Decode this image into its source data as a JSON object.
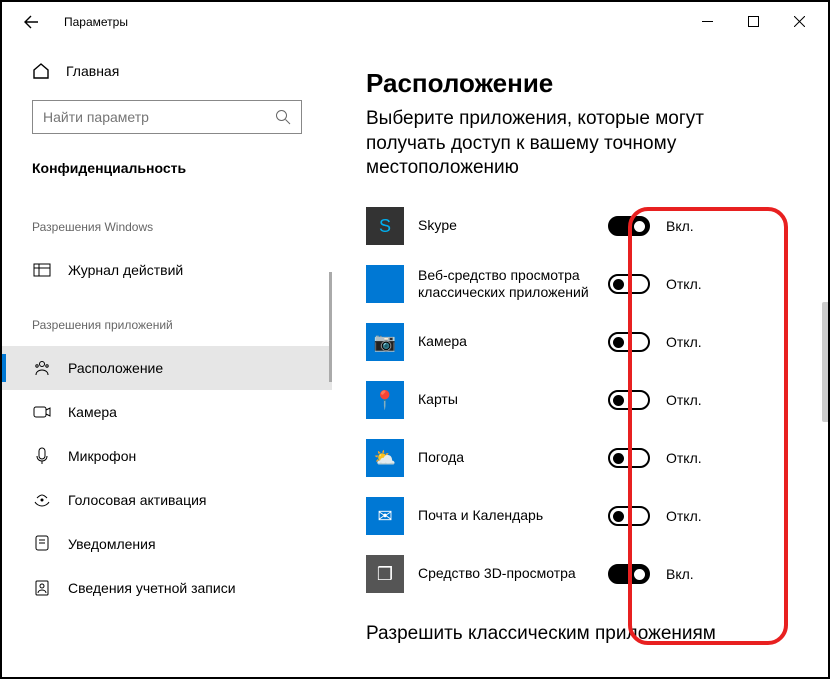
{
  "window": {
    "title": "Параметры"
  },
  "sidebar": {
    "home": "Главная",
    "search_placeholder": "Найти параметр",
    "category": "Конфиденциальность",
    "section1": "Разрешения Windows",
    "section2": "Разрешения приложений",
    "items1": [
      {
        "label": "Журнал действий"
      }
    ],
    "items2": [
      {
        "label": "Расположение"
      },
      {
        "label": "Камера"
      },
      {
        "label": "Микрофон"
      },
      {
        "label": "Голосовая активация"
      },
      {
        "label": "Уведомления"
      },
      {
        "label": "Сведения учетной записи"
      }
    ]
  },
  "main": {
    "title": "Расположение",
    "subtitle": "Выберите приложения, которые могут получать доступ к вашему точному местоположению",
    "bottom": "Разрешить классическим приложениям",
    "on_label": "Вкл.",
    "off_label": "Откл.",
    "apps": [
      {
        "name": "Skype",
        "on": true,
        "icon_bg": "#333333",
        "icon_fg": "#00aff0",
        "glyph": "S"
      },
      {
        "name": "Веб-средство просмотра классических приложений",
        "on": false,
        "icon_bg": "#0078d4",
        "icon_fg": "#ffffff",
        "glyph": ""
      },
      {
        "name": "Камера",
        "on": false,
        "icon_bg": "#0078d4",
        "icon_fg": "#ffffff",
        "glyph": "📷"
      },
      {
        "name": "Карты",
        "on": false,
        "icon_bg": "#0078d4",
        "icon_fg": "#ffffff",
        "glyph": "📍"
      },
      {
        "name": "Погода",
        "on": false,
        "icon_bg": "#0078d4",
        "icon_fg": "#ffffff",
        "glyph": "⛅"
      },
      {
        "name": "Почта и Календарь",
        "on": false,
        "icon_bg": "#0078d4",
        "icon_fg": "#ffffff",
        "glyph": "✉"
      },
      {
        "name": "Средство 3D-просмотра",
        "on": true,
        "icon_bg": "#555555",
        "icon_fg": "#ffffff",
        "glyph": "❒"
      }
    ]
  }
}
